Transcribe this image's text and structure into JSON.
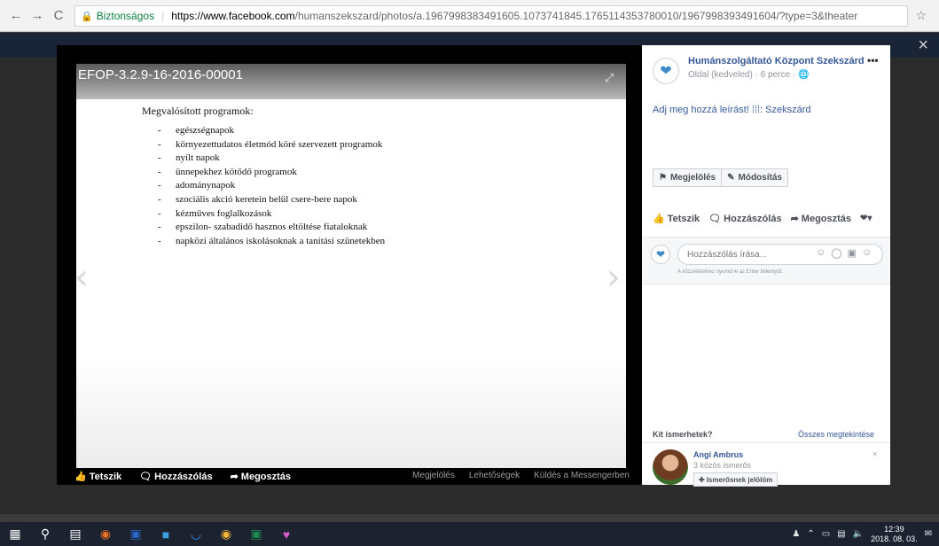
{
  "browser": {
    "back": "←",
    "forward": "→",
    "reload": "C",
    "secure_label": "Biztonságos",
    "url_host": "https://www.facebook.com",
    "url_path": "/humanszekszard/photos/a.1967998383491605.1073741845.1765114353780010/1967998393491604/?type=3&theater",
    "star": "☆"
  },
  "viewer": {
    "close": "×",
    "photo_title": "EFOP-3.2.9-16-2016-00001",
    "doc_heading": "Megvalósított programok:",
    "doc_items": [
      "egészségnapok",
      "környezettudatos életmód köré szervezett programok",
      "nyílt napok",
      "ünnepekhez kötődő programok",
      "adománynapok",
      "szociális akció keretein belül csere-bere napok",
      "kézműves foglalkozások",
      "epszilon- szabadidő hasznos eltöltése fiataloknak",
      "napközi általános iskolásoknak a tanítási szünetekben"
    ],
    "footer": {
      "like": "Tetszik",
      "comment": "Hozzászólás",
      "share": "Megosztás",
      "tag": "Megjelölés",
      "options": "Lehetőségek",
      "messenger": "Küldés a Messengerben"
    }
  },
  "panel": {
    "page_name": "Humánszolgáltató Központ Szekszárd",
    "more": "•••",
    "meta": "Oldal (kedveled) · 6 perce · ",
    "description": "Adj meg hozzá leírást! ⁞⁞⁞: Szekszárd",
    "tag_button": "Megjelölés",
    "edit_button": "Módosítás",
    "like": "Tetszik",
    "comment": "Hozzászólás",
    "share": "Megosztás",
    "comment_placeholder": "Hozzászólás írása...",
    "enter_hint": "A közzétételhez nyomd le az Enter billentyűt.",
    "pymk_title": "Kit ismerhetek?",
    "pymk_all": "Összes megtekintése",
    "person": {
      "name": "Angi Ambrus",
      "mutual": "3 közös ismerős",
      "add": "Ismerősnek jelölöm"
    }
  },
  "taskbar": {
    "time": "12:39",
    "date": "2018. 08. 03."
  }
}
